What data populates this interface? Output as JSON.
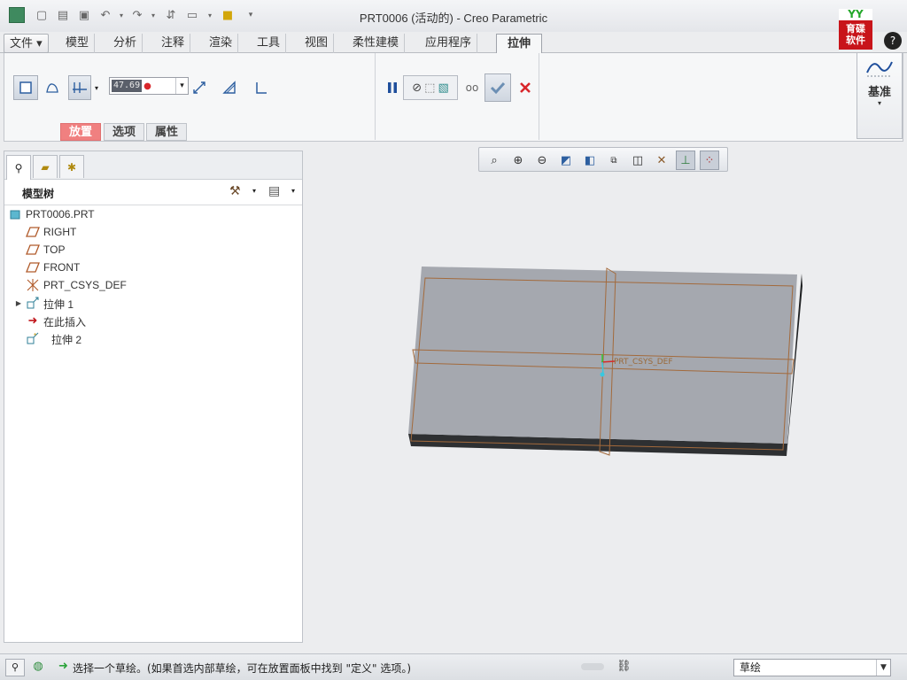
{
  "window": {
    "title": "PRT0006 (活动的) - Creo Parametric"
  },
  "logo": {
    "line1": "YY",
    "line2": "育碟",
    "line3": "软件"
  },
  "help": {
    "label": "?"
  },
  "tabs": [
    {
      "label": "文件 ▾"
    },
    {
      "label": "模型"
    },
    {
      "label": "分析"
    },
    {
      "label": "注释"
    },
    {
      "label": "渲染"
    },
    {
      "label": "工具"
    },
    {
      "label": "视图"
    },
    {
      "label": "柔性建模"
    },
    {
      "label": "应用程序"
    },
    {
      "label": "拉伸"
    }
  ],
  "ribbon": {
    "depth_value": "47.69",
    "subtabs": [
      {
        "label": "放置"
      },
      {
        "label": "选项"
      },
      {
        "label": "属性"
      }
    ],
    "datum_label": "基准"
  },
  "model_tree": {
    "header": "模型树",
    "items": [
      {
        "label": "PRT0006.PRT",
        "icon": "part-icon"
      },
      {
        "label": "RIGHT",
        "icon": "datum-plane-icon"
      },
      {
        "label": "TOP",
        "icon": "datum-plane-icon"
      },
      {
        "label": "FRONT",
        "icon": "datum-plane-icon"
      },
      {
        "label": "PRT_CSYS_DEF",
        "icon": "csys-icon"
      },
      {
        "label": "拉伸 1",
        "icon": "extrude-icon"
      },
      {
        "label": "在此插入",
        "icon": "insert-here-arrow-icon"
      },
      {
        "label": "拉伸 2",
        "icon": "extrude-new-icon"
      }
    ]
  },
  "canvas": {
    "csys_label": "PRT_CSYS_DEF"
  },
  "status": {
    "message": "选择一个草绘。(如果首选内部草绘，可在放置面板中找到 \"定义\" 选项。)",
    "filter": "草绘"
  },
  "colors": {
    "accent_red": "#d8262b",
    "hot_tab": "#f08080",
    "model_gray": "#a4a7ae",
    "datum_orange": "#b96a3a"
  }
}
